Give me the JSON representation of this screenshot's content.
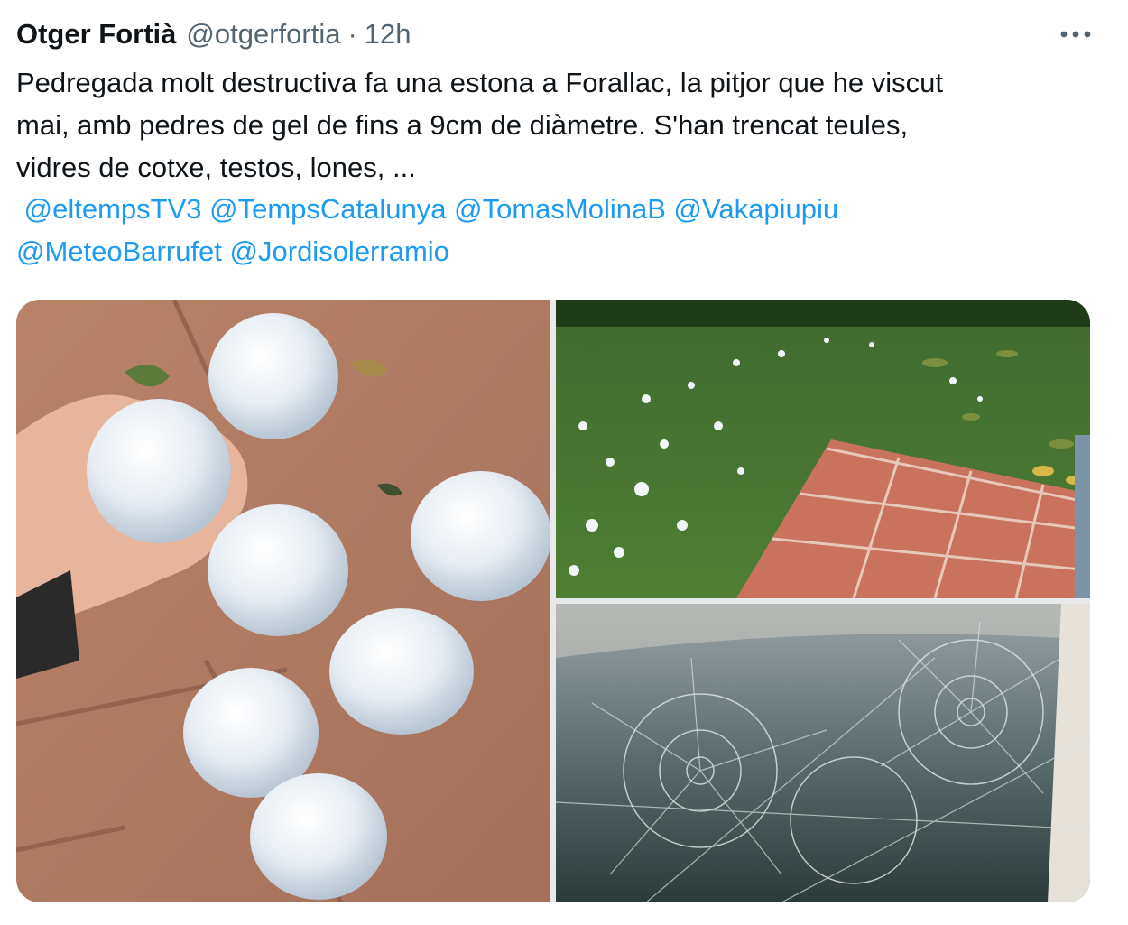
{
  "tweet": {
    "display_name": "Otger Fortià",
    "handle": "@otgerfortia",
    "separator": "·",
    "time": "12h",
    "more_icon": "more-horizontal-icon",
    "text_lines": [
      "Pedregada molt destructiva fa una estona a Forallac, la pitjor que he viscut",
      "mai, amb pedres de gel de fins a 9cm de diàmetre. S'han trencat teules,",
      "vidres de cotxe, testos, lones, ..."
    ],
    "mentions_line1": [
      "@eltempsTV3",
      "@TempsCatalunya",
      "@TomasMolinaB",
      "@Vakapiupiu"
    ],
    "mentions_line2": [
      "@MeteoBarrufet",
      "@Jordisolerramio"
    ]
  },
  "colors": {
    "text": "#0f1419",
    "secondary": "#536471",
    "link": "#1d9bf0"
  },
  "media": [
    {
      "subject": "giant hailstones held in a hand on terracotta tiles"
    },
    {
      "subject": "lawn covered with hail and leaves next to tiled steps"
    },
    {
      "subject": "car windshield shattered by hail"
    }
  ]
}
